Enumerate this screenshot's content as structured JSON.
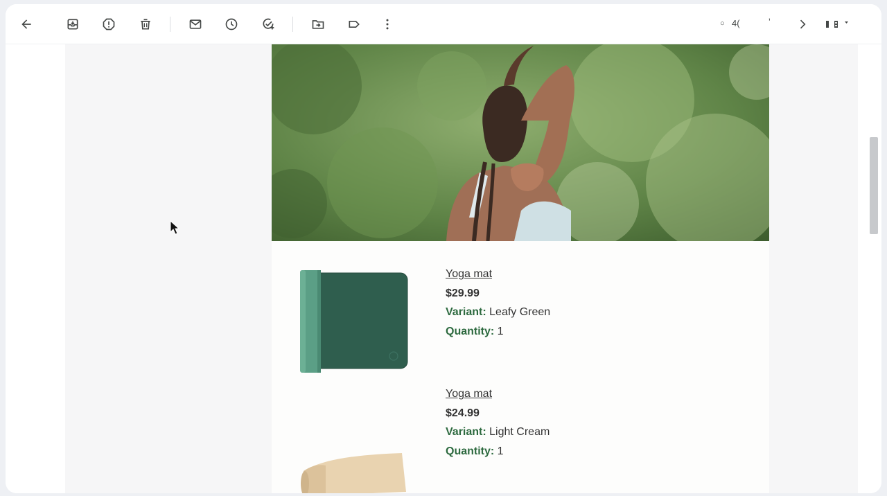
{
  "toolbar": {
    "buttons": [
      {
        "name": "back",
        "icon": "arrow-left-icon"
      },
      {
        "name": "archive",
        "icon": "archive-icon"
      },
      {
        "name": "report-spam",
        "icon": "report-spam-icon"
      },
      {
        "name": "delete",
        "icon": "trash-icon"
      },
      {
        "name": "mark-unread",
        "icon": "mail-icon"
      },
      {
        "name": "snooze",
        "icon": "clock-icon"
      },
      {
        "name": "add-task",
        "icon": "add-task-icon"
      },
      {
        "name": "move-to",
        "icon": "move-folder-icon"
      },
      {
        "name": "labels",
        "icon": "label-icon"
      },
      {
        "name": "more",
        "icon": "more-vert-icon"
      }
    ],
    "pager": {
      "count_text": "4(",
      "partial_text": "ʼ"
    }
  },
  "email": {
    "products": [
      {
        "name": "Yoga mat",
        "price": "$29.99",
        "variant_label": "Variant:",
        "variant": "Leafy Green",
        "quantity_label": "Quantity:",
        "quantity": "1"
      },
      {
        "name": "Yoga mat",
        "price": "$24.99",
        "variant_label": "Variant:",
        "variant": "Light Cream",
        "quantity_label": "Quantity:",
        "quantity": "1"
      }
    ]
  },
  "colors": {
    "accent_green": "#2d6a3f",
    "mat_green": "#2f5e4e",
    "mat_cream": "#e9d3b0"
  }
}
